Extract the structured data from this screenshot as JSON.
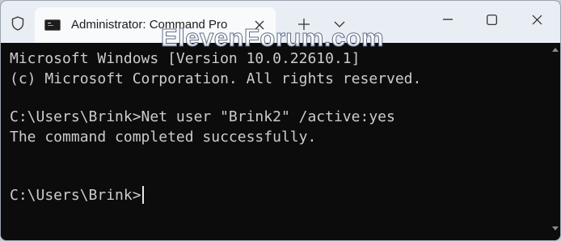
{
  "window": {
    "tab_title": "Administrator: Command Pro",
    "watermark": "ElevenForum.com"
  },
  "icons": {
    "shield": "shield-icon",
    "tab": "command-prompt-icon",
    "close_tab": "close-icon",
    "new_tab": "plus-icon",
    "dropdown": "chevron-down-icon",
    "minimize": "minimize-icon",
    "maximize": "maximize-icon",
    "close_window": "close-icon"
  },
  "terminal": {
    "lines": [
      "Microsoft Windows [Version 10.0.22610.1]",
      "(c) Microsoft Corporation. All rights reserved.",
      "",
      "C:\\Users\\Brink>Net user \"Brink2\" /active:yes",
      "The command completed successfully.",
      "",
      "",
      "C:\\Users\\Brink>"
    ]
  },
  "colors": {
    "titlebar_bg": "#e9eef4",
    "tab_bg": "#f9fafb",
    "terminal_bg": "#0c0c0c",
    "terminal_text": "#cccccc"
  }
}
